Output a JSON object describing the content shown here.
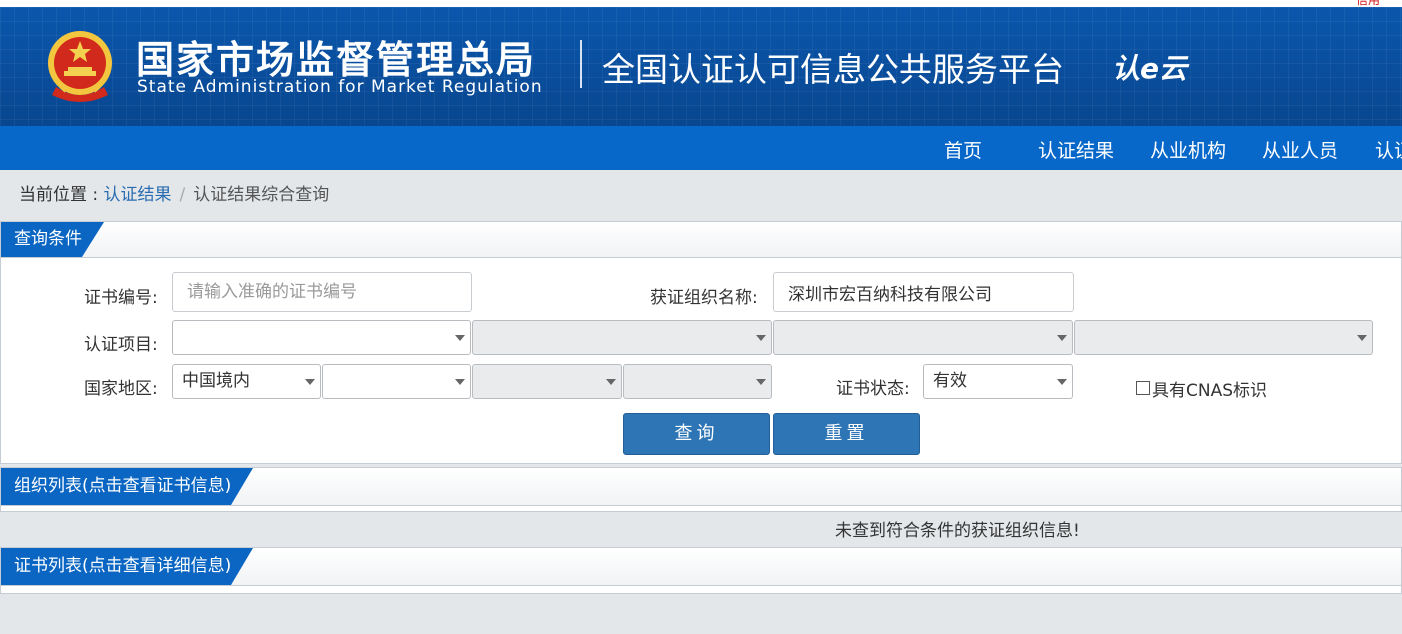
{
  "header": {
    "org_cn": "国家市场监督管理总局",
    "org_en": "State Administration  for  Market Regulation",
    "platform": "全国认证认可信息公共服务平台",
    "brand": "认e云",
    "top_red": "信用"
  },
  "nav": {
    "items": [
      "首页",
      "认证结果",
      "从业机构",
      "从业人员",
      "认证"
    ]
  },
  "breadcrumb": {
    "prefix": "当前位置 : ",
    "link": "认证结果",
    "separator": "/",
    "current": "认证结果综合查询"
  },
  "query_panel": {
    "title": "查询条件",
    "cert_no_label": "证书编号:",
    "cert_no_placeholder": "请输入准确的证书编号",
    "cert_no_value": "",
    "org_name_label": "获证组织名称:",
    "org_name_value": "深圳市宏百纳科技有限公司",
    "project_label": "认证项目:",
    "project_selects": [
      "",
      "",
      "",
      ""
    ],
    "region_label": "国家地区:",
    "region_selects": [
      "中国境内",
      "",
      "",
      ""
    ],
    "status_label": "证书状态:",
    "status_value": "有效",
    "cnas_label": "具有CNAS标识",
    "search_button": "查询",
    "reset_button": "重置"
  },
  "org_panel": {
    "title": "组织列表(点击查看证书信息)",
    "empty_message": "未查到符合条件的获证组织信息!"
  },
  "cert_panel": {
    "title": "证书列表(点击查看详细信息)"
  },
  "colors": {
    "header_bg": "#0a4f9f",
    "nav_bg": "#0868c9",
    "tab_bg": "#0a66c2",
    "button_bg": "#2e75b6",
    "link": "#2a6cb0",
    "page_bg": "#e3e7ea"
  },
  "icons": {
    "emblem": "national-emblem-icon",
    "select_arrow": "caret-down-icon"
  }
}
